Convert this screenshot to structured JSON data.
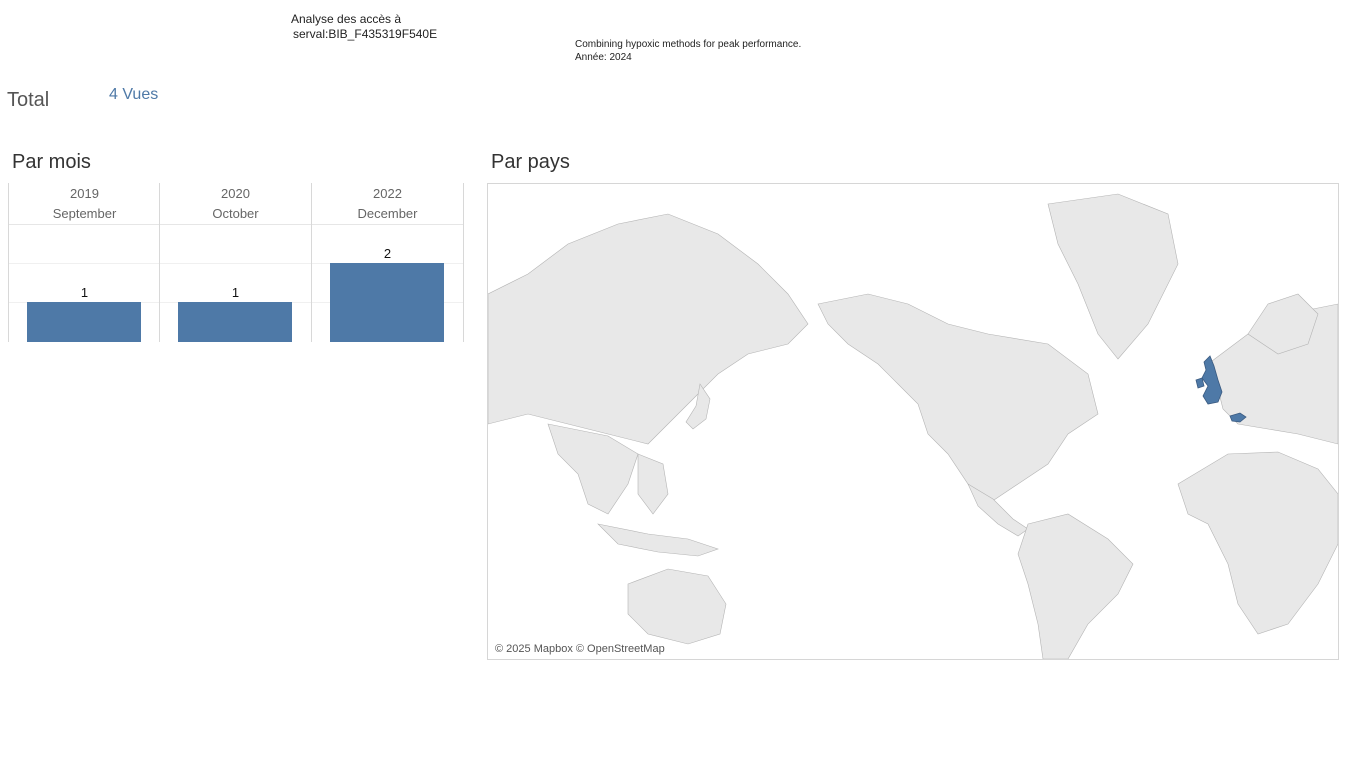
{
  "header": {
    "title_line1": "Analyse des accès à",
    "title_line2": "serval:BIB_F435319F540E",
    "subtitle_line1": "Combining hypoxic methods for peak performance.",
    "subtitle_line2": "Année: 2024"
  },
  "total": {
    "label": "Total",
    "value": "4 Vues"
  },
  "bars": {
    "title": "Par mois",
    "columns": [
      {
        "year": "2019",
        "month": "September",
        "value": "1"
      },
      {
        "year": "2020",
        "month": "October",
        "value": "1"
      },
      {
        "year": "2022",
        "month": "December",
        "value": "2"
      }
    ]
  },
  "chart_data": {
    "type": "bar",
    "categories": [
      "2019 September",
      "2020 October",
      "2022 December"
    ],
    "values": [
      1,
      1,
      2
    ],
    "title": "Par mois",
    "ylim": [
      0,
      2
    ]
  },
  "map": {
    "title": "Par pays",
    "attribution": "© 2025 Mapbox © OpenStreetMap",
    "highlighted_countries": [
      "United Kingdom",
      "Switzerland"
    ],
    "highlight_color": "#4e79a7",
    "land_color": "#e8e8e8"
  }
}
